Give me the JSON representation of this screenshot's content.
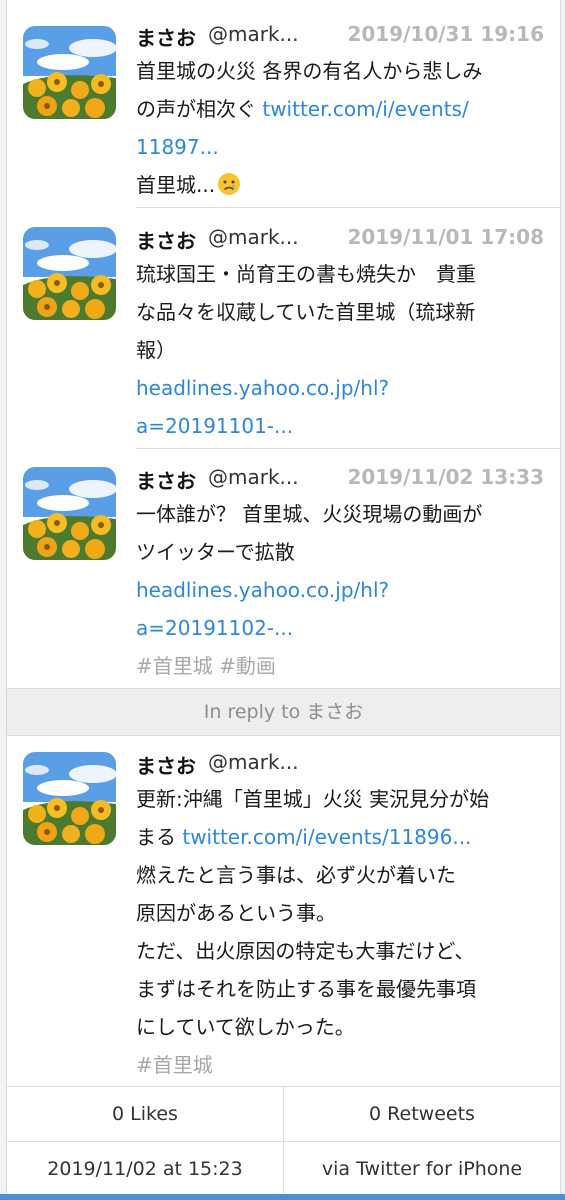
{
  "tweets": [
    {
      "name": "まさお",
      "handle": "@mark...",
      "timestamp": "2019/10/31 19:16",
      "line1": "首里城の火災 各界の有名人から悲しみ",
      "line2_text": "の声が相次ぐ ",
      "line2_link": "twitter.com/i/events/",
      "line3_link": "11897...",
      "line4_text": "首里城...",
      "emoji": "crying-face-icon"
    },
    {
      "name": "まさお",
      "handle": "@mark...",
      "timestamp": "2019/11/01 17:08",
      "line1": "琉球国王・尚育王の書も焼失か　貴重",
      "line2": "な品々を収蔵していた首里城（琉球新",
      "line3": "報）",
      "link1": "headlines.yahoo.co.jp/hl?",
      "link2": "a=20191101-..."
    },
    {
      "name": "まさお",
      "handle": "@mark...",
      "timestamp": "2019/11/02 13:33",
      "line1": "一体誰が？ 首里城、火災現場の動画が",
      "line2": "ツイッターで拡散",
      "link1": "headlines.yahoo.co.jp/hl?",
      "link2": "a=20191102-...",
      "tags": "#首里城 #動画"
    },
    {
      "name": "まさお",
      "handle": "@mark...",
      "line1": "更新:沖縄「首里城」火災 実況見分が始",
      "line2_text": "まる ",
      "line2_link": "twitter.com/i/events/11896...",
      "line3": "燃えたと言う事は、必ず火が着いた",
      "line4": "原因があるという事。",
      "line5": "ただ、出火原因の特定も大事だけど、",
      "line6": "まずはそれを防止する事を最優先事項",
      "line7": "にしていて欲しかった。",
      "tags": "#首里城"
    }
  ],
  "reply_bar": {
    "label": "In reply to まさお"
  },
  "stats": {
    "likes": "0 Likes",
    "retweets": "0 Retweets",
    "posted_at": "2019/11/02 at 15:23",
    "via": "via Twitter for iPhone"
  },
  "colors": {
    "link": "#2d86de",
    "timestamp": "#b8b8b8",
    "hashtag": "#a8a8a8",
    "accent": "#4a90d9"
  }
}
